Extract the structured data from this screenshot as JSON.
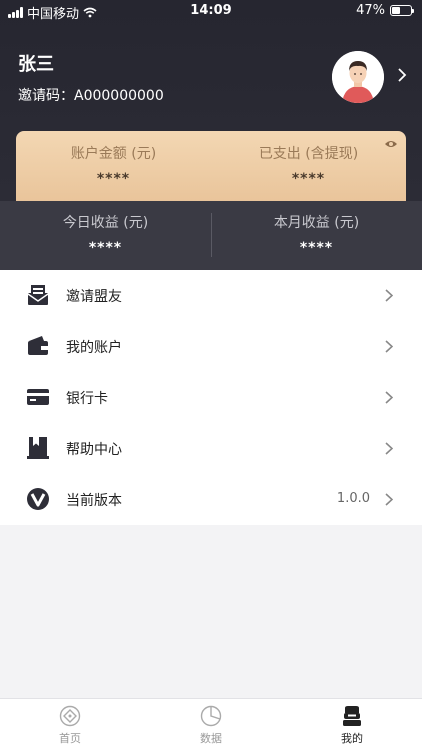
{
  "status_bar": {
    "carrier": "中国移动",
    "time": "14:09",
    "battery": "47%",
    "battery_level": 0.47
  },
  "profile": {
    "name": "张三",
    "invite_label": "邀请码：",
    "invite_code": "A000000000"
  },
  "balance": {
    "account_amount_label": "账户金额 (元)",
    "account_amount_value": "****",
    "spent_label": "已支出 (含提现)",
    "spent_value": "****"
  },
  "earnings": {
    "today_label": "今日收益 (元)",
    "today_value": "****",
    "month_label": "本月收益 (元)",
    "month_value": "****"
  },
  "menu": [
    {
      "label": "邀请盟友",
      "icon": "invite-icon",
      "value": ""
    },
    {
      "label": "我的账户",
      "icon": "wallet-icon",
      "value": ""
    },
    {
      "label": "银行卡",
      "icon": "bank-card-icon",
      "value": ""
    },
    {
      "label": "帮助中心",
      "icon": "help-book-icon",
      "value": ""
    },
    {
      "label": "当前版本",
      "icon": "version-logo-icon",
      "value": "1.0.0"
    }
  ],
  "tabbar": {
    "tabs": [
      {
        "label": "首页",
        "icon": "home-icon",
        "active": false
      },
      {
        "label": "数据",
        "icon": "pie-chart-icon",
        "active": false
      },
      {
        "label": "我的",
        "icon": "profile-icon",
        "active": true
      }
    ]
  },
  "colors": {
    "header_bg": "#2a2a34",
    "card_gold": "#eccaa2",
    "earnings_bg": "#3a3a44"
  }
}
